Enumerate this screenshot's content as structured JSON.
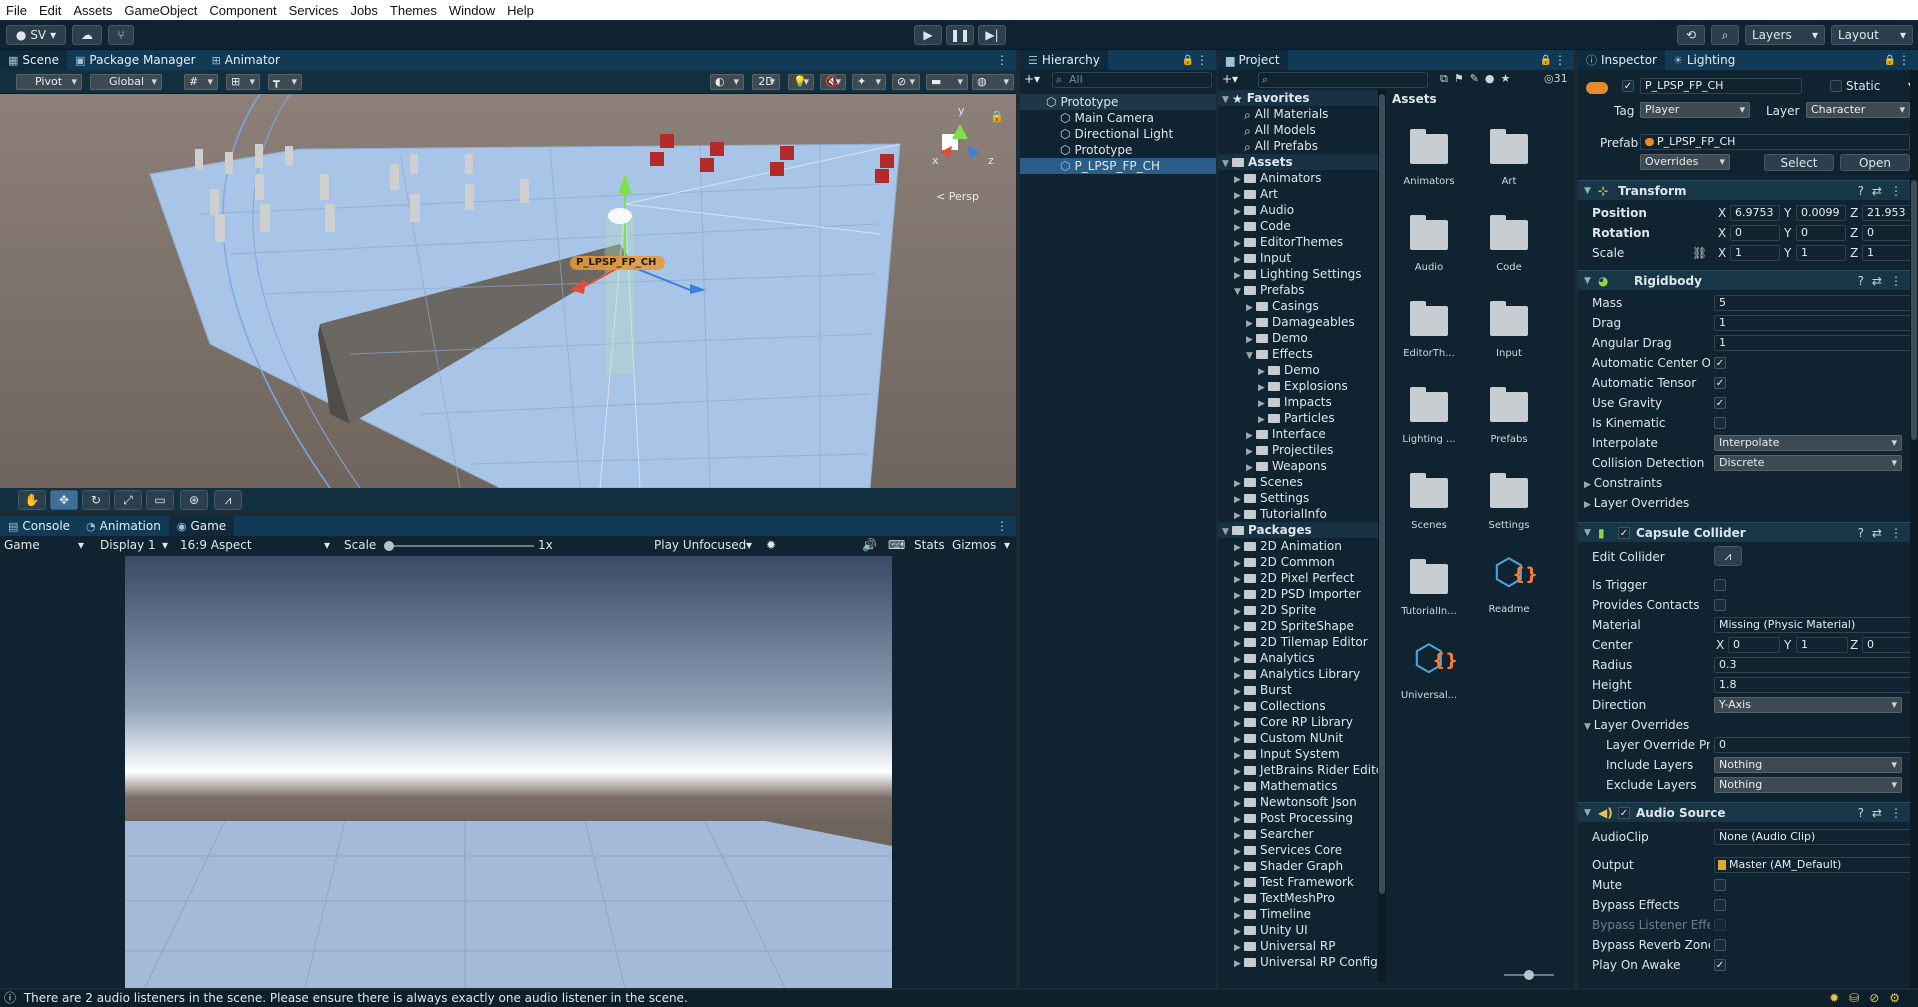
{
  "menu": [
    "File",
    "Edit",
    "Assets",
    "GameObject",
    "Component",
    "Services",
    "Jobs",
    "Themes",
    "Window",
    "Help"
  ],
  "toolbar": {
    "account_label": "SV",
    "layers_label": "Layers",
    "layout_label": "Layout"
  },
  "scene_tabs": [
    "Scene",
    "Package Manager",
    "Animator"
  ],
  "scene_toolbar": {
    "pivot": "Pivot",
    "global": "Global",
    "two_d": "2D"
  },
  "scene_view": {
    "object_label": "P_LPSP_FP_CH",
    "persp_label": "< Persp",
    "gizmo_y": "y",
    "gizmo_x": "x",
    "gizmo_z": "z"
  },
  "bottom_tabs": [
    "Console",
    "Animation",
    "Game"
  ],
  "game_toolbar": {
    "mode": "Game",
    "display": "Display 1",
    "aspect": "16:9 Aspect",
    "scale_label": "Scale",
    "scale_value": "1x",
    "play_mode": "Play Unfocused",
    "stats": "Stats",
    "gizmos": "Gizmos"
  },
  "hierarchy": {
    "tab": "Hierarchy",
    "search_placeholder": "All",
    "items": [
      {
        "label": "Prototype",
        "depth": 0,
        "expanded": true
      },
      {
        "label": "Main Camera",
        "depth": 1
      },
      {
        "label": "Directional Light",
        "depth": 1
      },
      {
        "label": "Prototype",
        "depth": 1
      },
      {
        "label": "P_LPSP_FP_CH",
        "depth": 1,
        "selected": true
      }
    ]
  },
  "project": {
    "tab": "Project",
    "count": "31",
    "tree": [
      {
        "label": "Favorites",
        "depth": 0,
        "bold": true
      },
      {
        "label": "All Materials",
        "depth": 1
      },
      {
        "label": "All Models",
        "depth": 1
      },
      {
        "label": "All Prefabs",
        "depth": 1
      },
      {
        "label": "Assets",
        "depth": 0,
        "bold": true
      },
      {
        "label": "Animators",
        "depth": 1
      },
      {
        "label": "Art",
        "depth": 1
      },
      {
        "label": "Audio",
        "depth": 1
      },
      {
        "label": "Code",
        "depth": 1
      },
      {
        "label": "EditorThemes",
        "depth": 1
      },
      {
        "label": "Input",
        "depth": 1
      },
      {
        "label": "Lighting Settings",
        "depth": 1
      },
      {
        "label": "Prefabs",
        "depth": 1
      },
      {
        "label": "Casings",
        "depth": 2
      },
      {
        "label": "Damageables",
        "depth": 2
      },
      {
        "label": "Demo",
        "depth": 2
      },
      {
        "label": "Effects",
        "depth": 2
      },
      {
        "label": "Demo",
        "depth": 3
      },
      {
        "label": "Explosions",
        "depth": 3
      },
      {
        "label": "Impacts",
        "depth": 3
      },
      {
        "label": "Particles",
        "depth": 3
      },
      {
        "label": "Interface",
        "depth": 2
      },
      {
        "label": "Projectiles",
        "depth": 2
      },
      {
        "label": "Weapons",
        "depth": 2
      },
      {
        "label": "Scenes",
        "depth": 1
      },
      {
        "label": "Settings",
        "depth": 1
      },
      {
        "label": "TutorialInfo",
        "depth": 1
      },
      {
        "label": "Packages",
        "depth": 0,
        "bold": true
      },
      {
        "label": "2D Animation",
        "depth": 1
      },
      {
        "label": "2D Common",
        "depth": 1
      },
      {
        "label": "2D Pixel Perfect",
        "depth": 1
      },
      {
        "label": "2D PSD Importer",
        "depth": 1
      },
      {
        "label": "2D Sprite",
        "depth": 1
      },
      {
        "label": "2D SpriteShape",
        "depth": 1
      },
      {
        "label": "2D Tilemap Editor",
        "depth": 1
      },
      {
        "label": "Analytics",
        "depth": 1
      },
      {
        "label": "Analytics Library",
        "depth": 1
      },
      {
        "label": "Burst",
        "depth": 1
      },
      {
        "label": "Collections",
        "depth": 1
      },
      {
        "label": "Core RP Library",
        "depth": 1
      },
      {
        "label": "Custom NUnit",
        "depth": 1
      },
      {
        "label": "Input System",
        "depth": 1
      },
      {
        "label": "JetBrains Rider Editc",
        "depth": 1
      },
      {
        "label": "Mathematics",
        "depth": 1
      },
      {
        "label": "Newtonsoft Json",
        "depth": 1
      },
      {
        "label": "Post Processing",
        "depth": 1
      },
      {
        "label": "Searcher",
        "depth": 1
      },
      {
        "label": "Services Core",
        "depth": 1
      },
      {
        "label": "Shader Graph",
        "depth": 1
      },
      {
        "label": "Test Framework",
        "depth": 1
      },
      {
        "label": "TextMeshPro",
        "depth": 1
      },
      {
        "label": "Timeline",
        "depth": 1
      },
      {
        "label": "Unity UI",
        "depth": 1
      },
      {
        "label": "Universal RP",
        "depth": 1
      },
      {
        "label": "Universal RP Config",
        "depth": 1
      }
    ],
    "grid_title": "Assets",
    "assets": [
      {
        "label": "Animators",
        "kind": "folder"
      },
      {
        "label": "Art",
        "kind": "folder"
      },
      {
        "label": "Audio",
        "kind": "folder"
      },
      {
        "label": "Code",
        "kind": "folder"
      },
      {
        "label": "EditorTh...",
        "kind": "folder"
      },
      {
        "label": "Input",
        "kind": "folder"
      },
      {
        "label": "Lighting ...",
        "kind": "folder"
      },
      {
        "label": "Prefabs",
        "kind": "folder"
      },
      {
        "label": "Scenes",
        "kind": "folder"
      },
      {
        "label": "Settings",
        "kind": "folder"
      },
      {
        "label": "TutorialIn...",
        "kind": "folder"
      },
      {
        "label": "Readme",
        "kind": "package"
      },
      {
        "label": "Universal...",
        "kind": "package"
      }
    ]
  },
  "inspector": {
    "tabs": [
      "Inspector",
      "Lighting"
    ],
    "object_name": "P_LPSP_FP_CH",
    "static_label": "Static",
    "tag_label": "Tag",
    "tag_value": "Player",
    "layer_label": "Layer",
    "layer_value": "Character",
    "prefab_label": "Prefab",
    "prefab_value": "P_LPSP_FP_CH",
    "overrides": "Overrides",
    "select": "Select",
    "open": "Open",
    "transform": {
      "title": "Transform",
      "position": {
        "label": "Position",
        "x": "6.9753",
        "y": "0.0099",
        "z": "21.953"
      },
      "rotation": {
        "label": "Rotation",
        "x": "0",
        "y": "0",
        "z": "0"
      },
      "scale": {
        "label": "Scale",
        "x": "1",
        "y": "1",
        "z": "1"
      }
    },
    "rigidbody": {
      "title": "Rigidbody",
      "mass_label": "Mass",
      "mass": "5",
      "drag_label": "Drag",
      "drag": "1",
      "angular_label": "Angular Drag",
      "angular": "1",
      "auto_center_label": "Automatic Center Of I",
      "auto_tensor_label": "Automatic Tensor",
      "gravity_label": "Use Gravity",
      "kinematic_label": "Is Kinematic",
      "interpolate_label": "Interpolate",
      "interpolate": "Interpolate",
      "collision_label": "Collision Detection",
      "collision": "Discrete",
      "constraints_label": "Constraints",
      "layer_overrides_label": "Layer Overrides"
    },
    "capsule": {
      "title": "Capsule Collider",
      "edit_label": "Edit Collider",
      "trigger_label": "Is Trigger",
      "contacts_label": "Provides Contacts",
      "material_label": "Material",
      "material": "Missing (Physic Material)",
      "center_label": "Center",
      "cx": "0",
      "cy": "1",
      "cz": "0",
      "radius_label": "Radius",
      "radius": "0.3",
      "height_label": "Height",
      "height": "1.8",
      "direction_label": "Direction",
      "direction": "Y-Axis",
      "layer_overrides_label": "Layer Overrides",
      "priority_label": "Layer Override Pric",
      "priority": "0",
      "include_label": "Include Layers",
      "include": "Nothing",
      "exclude_label": "Exclude Layers",
      "exclude": "Nothing"
    },
    "audio": {
      "title": "Audio Source",
      "clip_label": "AudioClip",
      "clip": "None (Audio Clip)",
      "output_label": "Output",
      "output": "Master (AM_Default)",
      "mute_label": "Mute",
      "bypass_label": "Bypass Effects",
      "bypass_listener_label": "Bypass Listener Effec",
      "bypass_reverb_label": "Bypass Reverb Zones",
      "play_awake_label": "Play On Awake"
    }
  },
  "status": {
    "message": "There are 2 audio listeners in the scene. Please ensure there is always exactly one audio listener in the scene."
  }
}
